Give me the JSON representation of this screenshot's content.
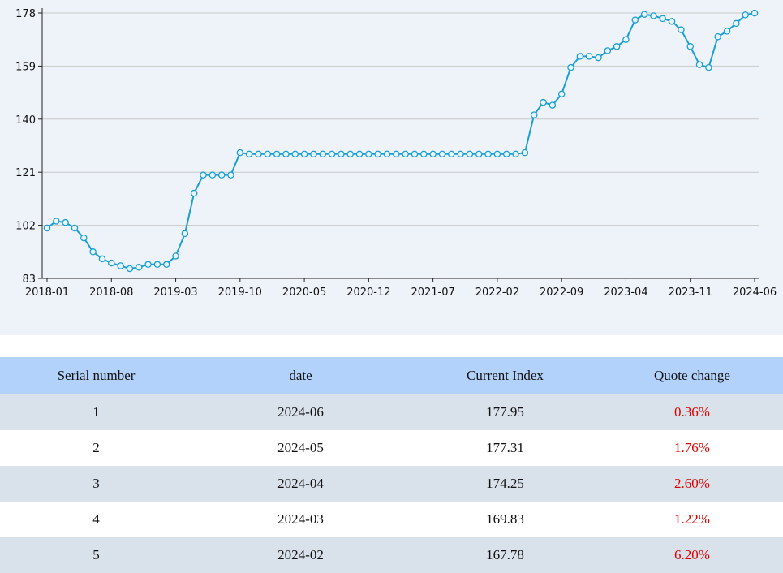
{
  "chart_data": {
    "type": "line",
    "x_labels": [
      "2018-01",
      "2018-08",
      "2019-03",
      "2019-10",
      "2020-05",
      "2020-12",
      "2021-07",
      "2022-02",
      "2022-09",
      "2023-04",
      "2023-11",
      "2024-06"
    ],
    "y_ticks": [
      83,
      102,
      121,
      140,
      159,
      178
    ],
    "ylim": [
      83,
      178
    ],
    "x": [
      "2018-01",
      "2018-02",
      "2018-03",
      "2018-04",
      "2018-05",
      "2018-06",
      "2018-07",
      "2018-08",
      "2018-09",
      "2018-10",
      "2018-11",
      "2018-12",
      "2019-01",
      "2019-02",
      "2019-03",
      "2019-04",
      "2019-05",
      "2019-06",
      "2019-07",
      "2019-08",
      "2019-09",
      "2019-10",
      "2019-11",
      "2019-12",
      "2020-01",
      "2020-02",
      "2020-03",
      "2020-04",
      "2020-05",
      "2020-06",
      "2020-07",
      "2020-08",
      "2020-09",
      "2020-10",
      "2020-11",
      "2020-12",
      "2021-01",
      "2021-02",
      "2021-03",
      "2021-04",
      "2021-05",
      "2021-06",
      "2021-07",
      "2021-08",
      "2021-09",
      "2021-10",
      "2021-11",
      "2021-12",
      "2022-01",
      "2022-02",
      "2022-03",
      "2022-04",
      "2022-05",
      "2022-06",
      "2022-07",
      "2022-08",
      "2022-09",
      "2022-10",
      "2022-11",
      "2022-12",
      "2023-01",
      "2023-02",
      "2023-03",
      "2023-04",
      "2023-05",
      "2023-06",
      "2023-07",
      "2023-08",
      "2023-09",
      "2023-10",
      "2023-11",
      "2023-12",
      "2024-01",
      "2024-02",
      "2024-03",
      "2024-04",
      "2024-05",
      "2024-06"
    ],
    "values": [
      101,
      103.5,
      103,
      101,
      97.5,
      92.5,
      90,
      88.5,
      87.5,
      86.5,
      87,
      88,
      88,
      88,
      91,
      99,
      113.5,
      120,
      120,
      120,
      120,
      128,
      127.5,
      127.5,
      127.5,
      127.5,
      127.5,
      127.5,
      127.5,
      127.5,
      127.5,
      127.5,
      127.5,
      127.5,
      127.5,
      127.5,
      127.5,
      127.5,
      127.5,
      127.5,
      127.5,
      127.5,
      127.5,
      127.5,
      127.5,
      127.5,
      127.5,
      127.5,
      127.5,
      127.5,
      127.5,
      127.5,
      128,
      141.5,
      146,
      145,
      149,
      158.5,
      162.5,
      162.5,
      162,
      164.5,
      166,
      168.5,
      175.5,
      177.5,
      177,
      176,
      175,
      172,
      166,
      159.5,
      158.5,
      169.5,
      171.5,
      174.25,
      177.31,
      177.95
    ],
    "grid": true,
    "line_color": "#1a9fd4"
  },
  "table": {
    "headers": [
      "Serial number",
      "date",
      "Current Index",
      "Quote change"
    ],
    "rows": [
      [
        "1",
        "2024-06",
        "177.95",
        "0.36%"
      ],
      [
        "2",
        "2024-05",
        "177.31",
        "1.76%"
      ],
      [
        "3",
        "2024-04",
        "174.25",
        "2.60%"
      ],
      [
        "4",
        "2024-03",
        "169.83",
        "1.22%"
      ],
      [
        "5",
        "2024-02",
        "167.78",
        "6.20%"
      ]
    ]
  }
}
